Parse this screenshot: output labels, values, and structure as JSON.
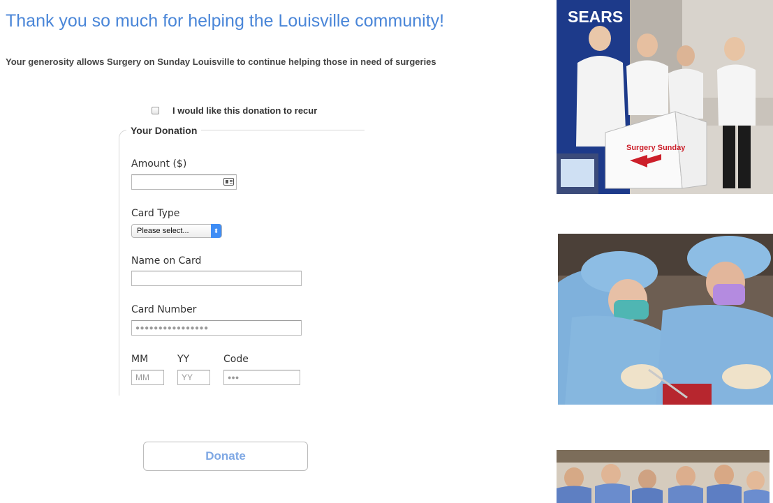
{
  "header": {
    "title": "Thank you so much for helping the Louisville community!",
    "subtitle": "Your generosity allows Surgery on Sunday Louisville to continue helping those in need of surgeries"
  },
  "recur": {
    "label": "I would like this donation to recur",
    "checked": false
  },
  "donation": {
    "legend": "Your Donation",
    "amount": {
      "label": "Amount ($)",
      "value": "",
      "icon": "contact-card-icon"
    },
    "card_type": {
      "label": "Card Type",
      "selected": "Please select..."
    },
    "name_on_card": {
      "label": "Name on Card",
      "value": ""
    },
    "card_number": {
      "label": "Card Number",
      "placeholder": "●●●●●●●●●●●●●●●●"
    },
    "expiry": {
      "mm_label": "MM",
      "mm_placeholder": "MM",
      "yy_label": "YY",
      "yy_placeholder": "YY",
      "code_label": "Code",
      "code_placeholder": "●●●"
    }
  },
  "actions": {
    "donate_label": "Donate"
  },
  "photos": [
    {
      "name": "volunteers-photo",
      "sign_text": "SEARS",
      "box_text": "Surgery Sunday"
    },
    {
      "name": "surgeons-photo"
    },
    {
      "name": "team-photo"
    }
  ],
  "colors": {
    "heading": "#4a86d8",
    "donate_text": "#7fa8e4",
    "select_accent": "#3f8df5"
  }
}
